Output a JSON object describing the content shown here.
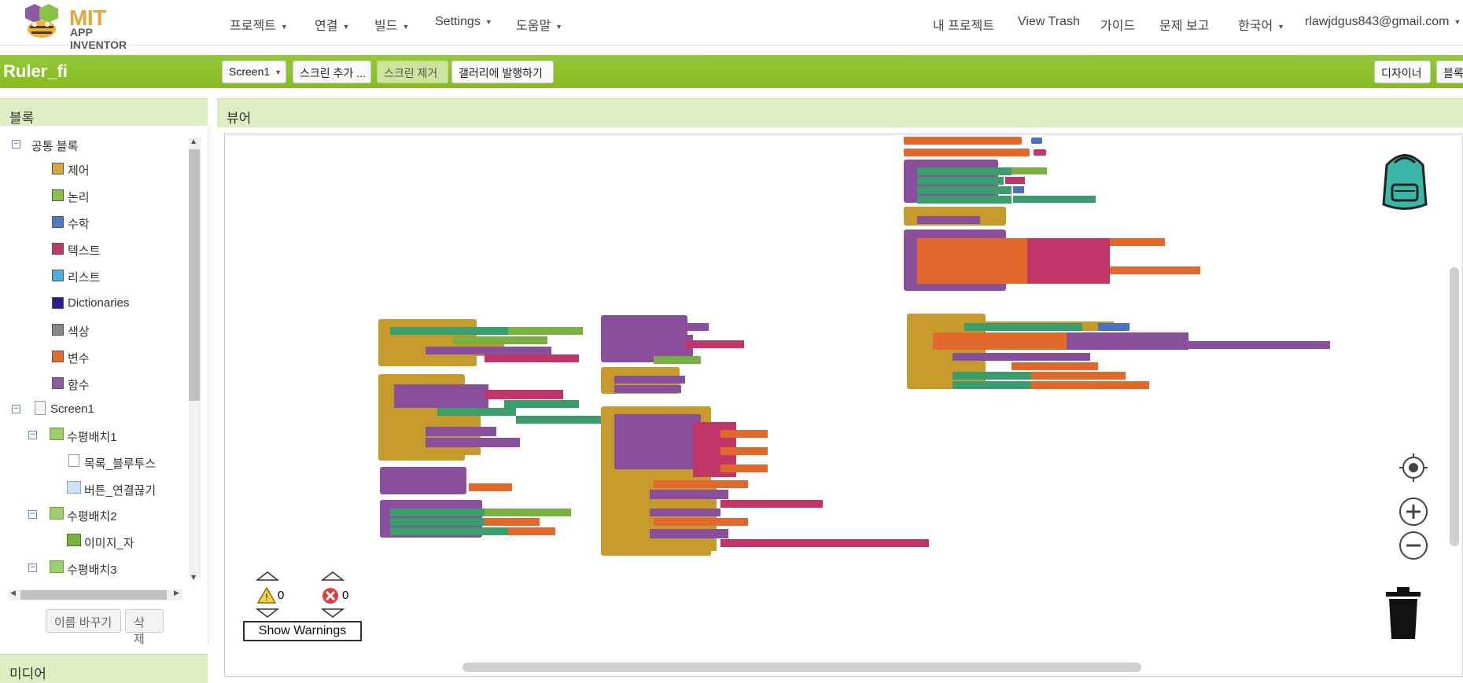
{
  "app": {
    "logo_line1": "MIT",
    "logo_line2": "APP INVENTOR"
  },
  "nav": {
    "left": [
      "프로젝트",
      "연결",
      "빌드",
      "Settings",
      "도움말"
    ],
    "right": {
      "my_projects": "내 프로젝트",
      "view_trash": "View Trash",
      "guide": "가이드",
      "report": "문제 보고",
      "language": "한국어",
      "account": "rlawjdgus843@gmail.com"
    }
  },
  "project": {
    "name": "Ruler_fi",
    "screen_select": "Screen1",
    "add_screen": "스크린 추가 ...",
    "remove_screen": "스크린 제거",
    "publish_gallery": "갤러리에 발행하기",
    "designer": "디자이너",
    "blocks": "블록"
  },
  "blocks_panel": {
    "title": "블록",
    "builtin": "공통 블록",
    "categories": [
      {
        "label": "제어",
        "color": "#d8a53a"
      },
      {
        "label": "논리",
        "color": "#8cbf45"
      },
      {
        "label": "수학",
        "color": "#4a7cc0"
      },
      {
        "label": "텍스트",
        "color": "#c0396b"
      },
      {
        "label": "리스트",
        "color": "#4ab0d9"
      },
      {
        "label": "Dictionaries",
        "color": "#2d1a8c"
      },
      {
        "label": "색상",
        "color": "#888888"
      },
      {
        "label": "변수",
        "color": "#e56b2d"
      },
      {
        "label": "함수",
        "color": "#8f5aa0"
      }
    ],
    "screen": "Screen1",
    "components": [
      {
        "label": "수평배치1",
        "level": 1,
        "icon": "arrangement"
      },
      {
        "label": "목록_블루투스",
        "level": 2,
        "icon": "listpicker"
      },
      {
        "label": "버튼_연결끊기",
        "level": 2,
        "icon": "button"
      },
      {
        "label": "수평배치2",
        "level": 1,
        "icon": "arrangement"
      },
      {
        "label": "이미지_자",
        "level": 2,
        "icon": "image"
      },
      {
        "label": "수평배치3",
        "level": 1,
        "icon": "arrangement"
      }
    ],
    "rename": "이름 바꾸기",
    "delete": "삭제",
    "media": "미디어"
  },
  "viewer": {
    "title": "뷰어",
    "warnings_count": "0",
    "errors_count": "0",
    "show_warnings": "Show Warnings"
  },
  "colors": {
    "green_bar": "#8bc34a",
    "panel_head": "#dfeec2",
    "control": "#c79a2c",
    "procedure": "#8a4f9c",
    "variable": "#e0692b",
    "text": "#c13568",
    "logic": "#7ab040",
    "component": "#3a9d6c",
    "math": "#4a73bd"
  }
}
